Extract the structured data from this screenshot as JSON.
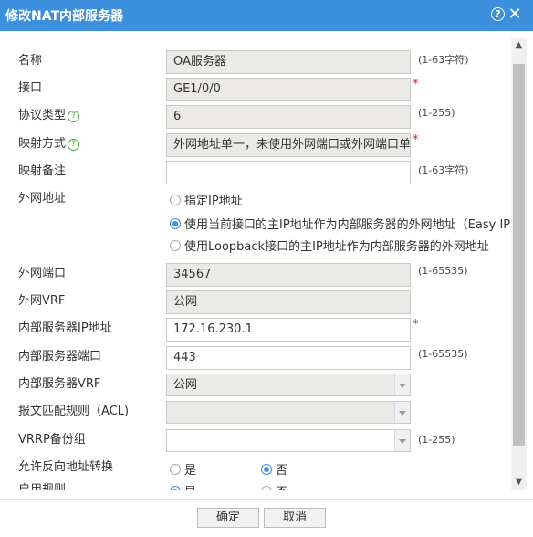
{
  "dialog": {
    "title": "修改NAT内部服务器"
  },
  "form": {
    "name": {
      "label": "名称",
      "value": "OA服务器",
      "hint": "(1-63字符)"
    },
    "interface": {
      "label": "接口",
      "value": "GE1/0/0",
      "required": "*"
    },
    "protocol": {
      "label": "协议类型",
      "value": "6",
      "hint": "(1-255)"
    },
    "mapping_mode": {
      "label": "映射方式",
      "value": "外网地址单一，未使用外网端口或外网端口单一",
      "required": "*"
    },
    "mapping_note": {
      "label": "映射备注",
      "value": "",
      "hint": "(1-63字符)"
    },
    "external_address": {
      "label": "外网地址",
      "options": [
        {
          "label": "指定IP地址",
          "selected": false
        },
        {
          "label": "使用当前接口的主IP地址作为内部服务器的外网地址（Easy IP)",
          "selected": true
        },
        {
          "label": "使用Loopback接口的主IP地址作为内部服务器的外网地址",
          "selected": false
        }
      ]
    },
    "external_port": {
      "label": "外网端口",
      "value": "34567",
      "hint": "(1-65535)"
    },
    "external_vrf": {
      "label": "外网VRF",
      "value": "公网"
    },
    "internal_ip": {
      "label": "内部服务器IP地址",
      "value": "172.16.230.1",
      "required": "*"
    },
    "internal_port": {
      "label": "内部服务器端口",
      "value": "443",
      "hint": "(1-65535)"
    },
    "internal_vrf": {
      "label": "内部服务器VRF",
      "value": "公网"
    },
    "acl": {
      "label": "报文匹配规则（ACL)",
      "value": ""
    },
    "vrrp": {
      "label": "VRRP备份组",
      "value": "",
      "hint": "(1-255)"
    },
    "reverse_nat": {
      "label": "允许反向地址转换",
      "yes": "是",
      "no": "否",
      "selected": "no"
    },
    "enable_rule": {
      "label": "启用规则",
      "yes": "是",
      "no": "否",
      "selected": "yes"
    }
  },
  "buttons": {
    "ok": "确定",
    "cancel": "取消"
  },
  "colors": {
    "titlebar": "#3c8fdc",
    "required": "#e0141f",
    "help": "#3aaa35"
  },
  "icons": {
    "help": "question-circle-icon",
    "close": "close-icon"
  }
}
